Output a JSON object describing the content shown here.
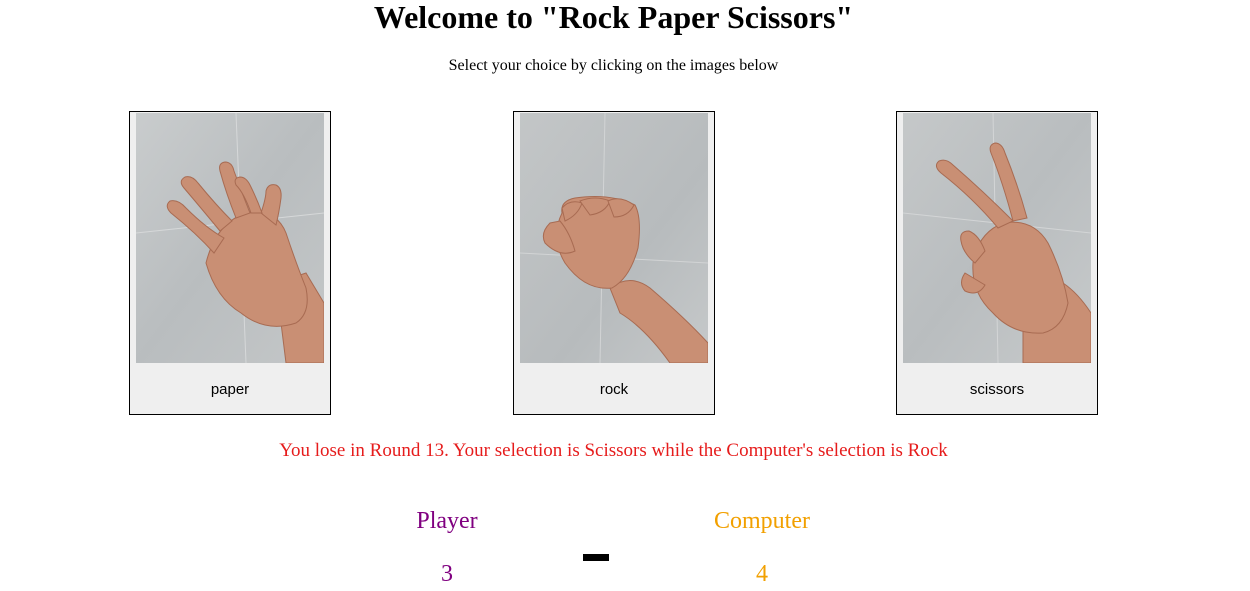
{
  "page": {
    "title": "Welcome to \"Rock Paper Scissors\"",
    "subtitle": "Select your choice by clicking on the images below"
  },
  "choices": [
    {
      "label": "paper",
      "icon": "open-hand-icon"
    },
    {
      "label": "rock",
      "icon": "fist-icon"
    },
    {
      "label": "scissors",
      "icon": "peace-sign-hand-icon"
    }
  ],
  "result": {
    "message": "You lose in Round 13. Your selection is Scissors while the Computer's selection is Rock",
    "color": "#e61c1c"
  },
  "score": {
    "player_label": "Player",
    "player_score": "3",
    "player_color": "#800080",
    "computer_label": "Computer",
    "computer_score": "4",
    "computer_color": "#f2a000"
  }
}
